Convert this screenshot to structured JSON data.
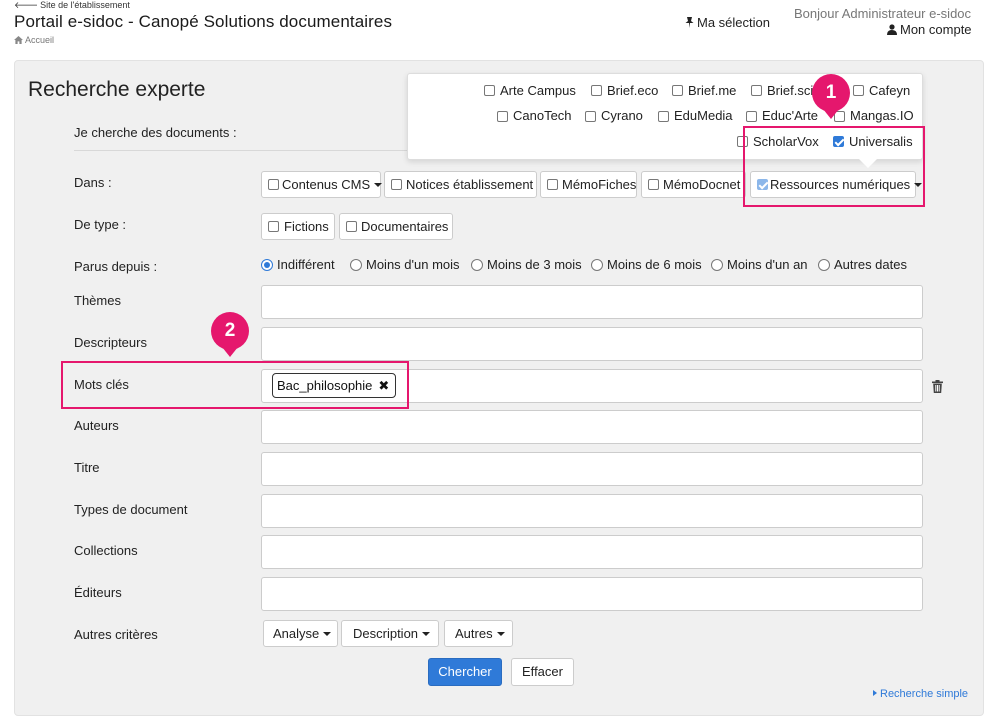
{
  "header": {
    "back_link": "Site de l'établissement",
    "title": "Portail e-sidoc - Canopé Solutions documentaires",
    "home": "Accueil",
    "ma_selection": "Ma sélection",
    "greeting": "Bonjour Administrateur e-sidoc",
    "account": "Mon compte"
  },
  "search": {
    "title": "Recherche experte",
    "intro": "Je cherche des documents :"
  },
  "resources_popover": {
    "items": [
      {
        "label": "Arte Campus",
        "checked": false
      },
      {
        "label": "Brief.eco",
        "checked": false
      },
      {
        "label": "Brief.me",
        "checked": false
      },
      {
        "label": "Brief.scie",
        "checked": false
      },
      {
        "label": "Cafeyn",
        "checked": false
      },
      {
        "label": "CanoTech",
        "checked": false
      },
      {
        "label": "Cyrano",
        "checked": false
      },
      {
        "label": "EduMedia",
        "checked": false
      },
      {
        "label": "Educ'Arte",
        "checked": false
      },
      {
        "label": "Mangas.IO",
        "checked": false
      },
      {
        "label": "ScholarVox",
        "checked": false
      },
      {
        "label": "Universalis",
        "checked": true
      }
    ]
  },
  "dans": {
    "label": "Dans :",
    "options": [
      {
        "label": "Contenus CMS",
        "dropdown": true,
        "checked": false
      },
      {
        "label": "Notices établissement",
        "dropdown": false,
        "checked": false
      },
      {
        "label": "MémoFiches",
        "dropdown": false,
        "checked": false
      },
      {
        "label": "MémoDocnet",
        "dropdown": false,
        "checked": false
      },
      {
        "label": "Ressources numériques",
        "dropdown": true,
        "checked": "partial"
      }
    ]
  },
  "type": {
    "label": "De type :",
    "options": [
      {
        "label": "Fictions",
        "checked": false
      },
      {
        "label": "Documentaires",
        "checked": false
      }
    ]
  },
  "parus": {
    "label": "Parus depuis :",
    "selected": "Indifférent",
    "options": [
      "Indifférent",
      "Moins d'un mois",
      "Moins de 3 mois",
      "Moins de 6 mois",
      "Moins d'un an",
      "Autres dates"
    ]
  },
  "fields": {
    "themes": {
      "label": "Thèmes",
      "value": ""
    },
    "descripteurs": {
      "label": "Descripteurs",
      "value": ""
    },
    "mots_cles": {
      "label": "Mots clés",
      "tag": "Bac_philosophie"
    },
    "auteurs": {
      "label": "Auteurs",
      "value": ""
    },
    "titre": {
      "label": "Titre",
      "value": ""
    },
    "types_document": {
      "label": "Types de document",
      "value": ""
    },
    "collections": {
      "label": "Collections",
      "value": ""
    },
    "editeurs": {
      "label": "Éditeurs",
      "value": ""
    }
  },
  "autres": {
    "label": "Autres critères",
    "buttons": [
      "Analyse",
      "Description",
      "Autres"
    ]
  },
  "actions": {
    "search": "Chercher",
    "clear": "Effacer",
    "simple": "Recherche simple"
  },
  "annotations": {
    "badge1": "1",
    "badge2": "2",
    "color": "#e5176d"
  },
  "colors": {
    "accent": "#2f7ad8",
    "highlight": "#e5176d"
  }
}
